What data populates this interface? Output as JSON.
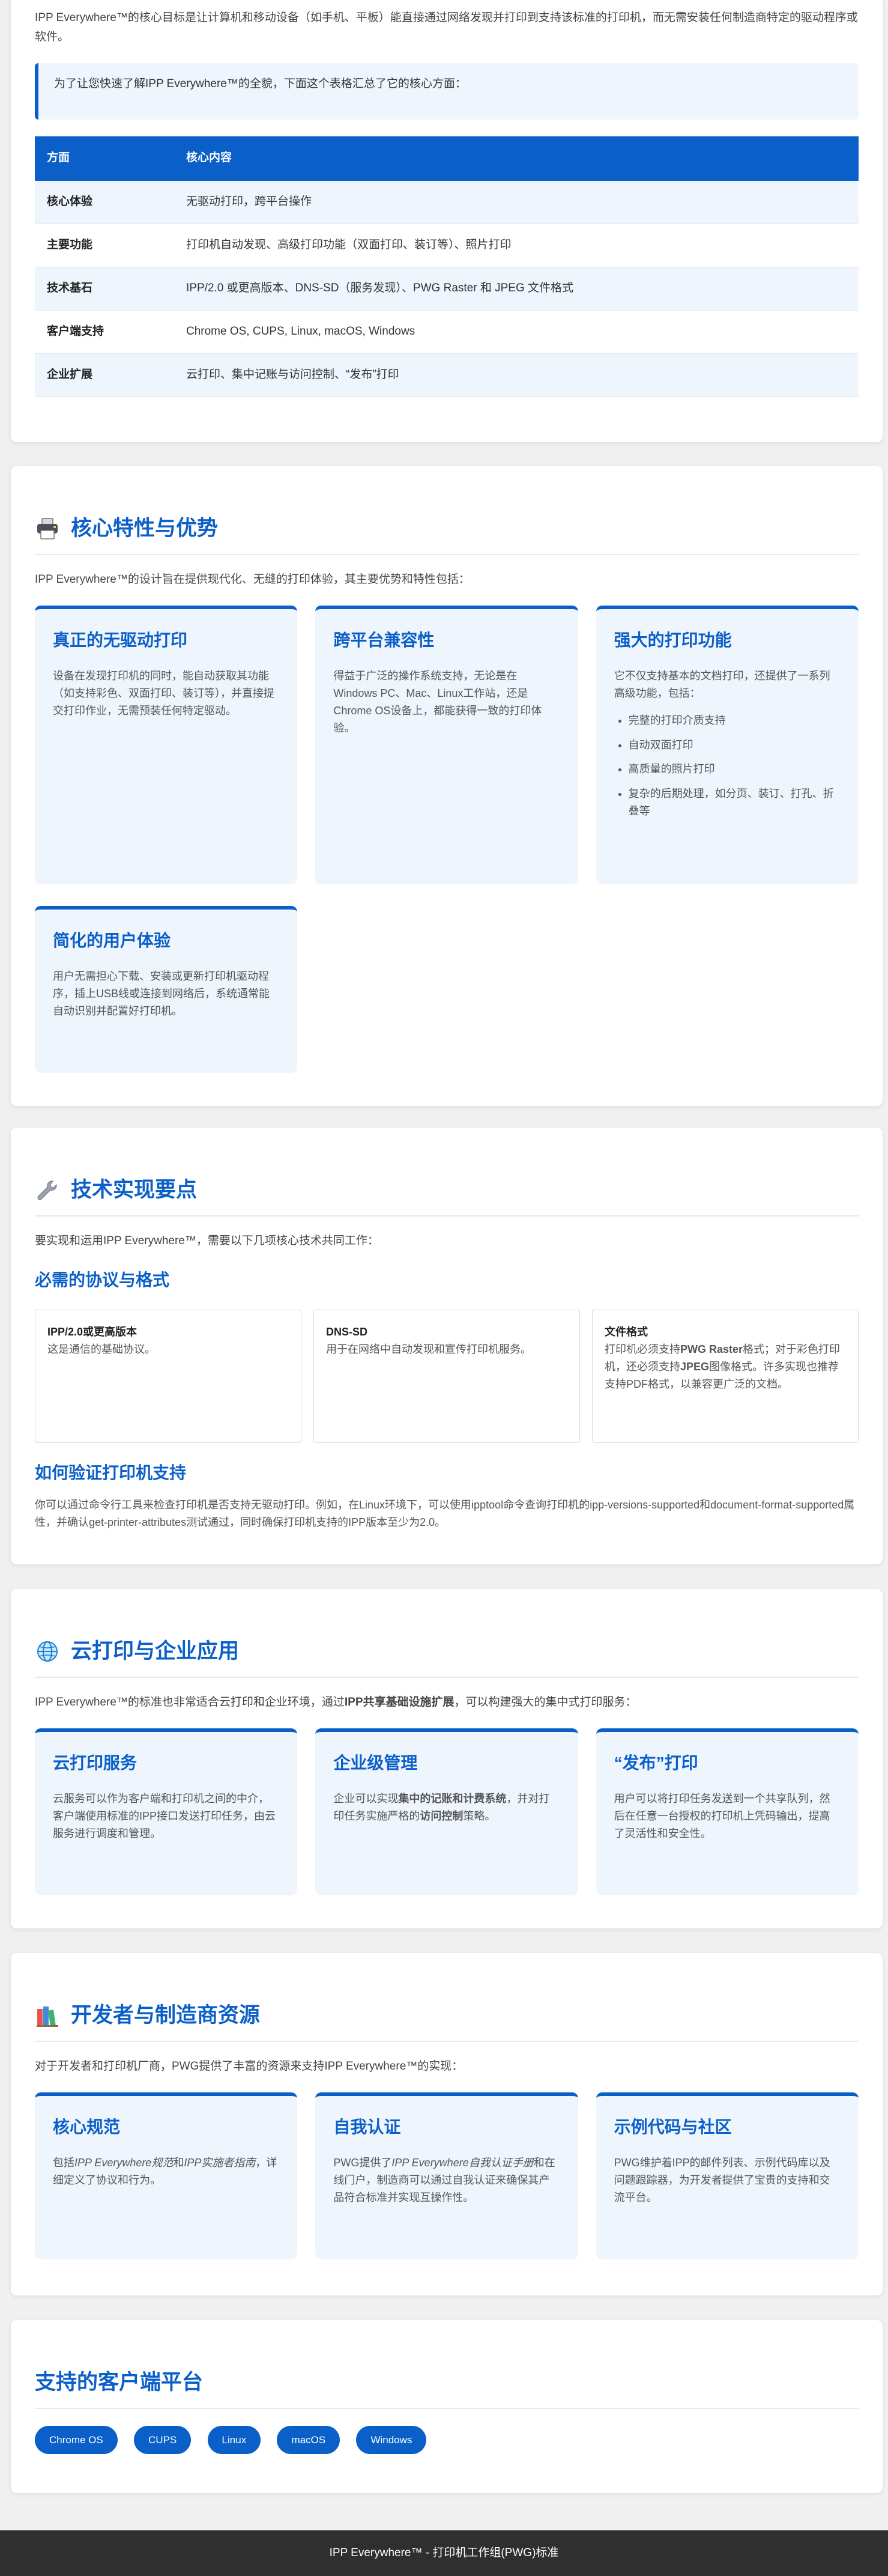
{
  "overview": {
    "intro": "IPP Everywhere™的核心目标是让计算机和移动设备（如手机、平板）能直接通过网络发现并打印到支持该标准的打印机，而无需安装任何制造商特定的驱动程序或软件。",
    "callout": "为了让您快速了解IPP Everywhere™的全貌，下面这个表格汇总了它的核心方面：",
    "table_headers": [
      "方面",
      "核心内容"
    ],
    "rows": [
      {
        "aspect": "核心体验",
        "content": "无驱动打印，跨平台操作"
      },
      {
        "aspect": "主要功能",
        "content": "打印机自动发现、高级打印功能（双面打印、装订等）、照片打印"
      },
      {
        "aspect": "技术基石",
        "content": "IPP/2.0 或更高版本、DNS-SD（服务发现）、PWG Raster 和 JPEG 文件格式"
      },
      {
        "aspect": "客户端支持",
        "content": "Chrome OS, CUPS, Linux, macOS, Windows"
      },
      {
        "aspect": "企业扩展",
        "content": "云打印、集中记账与访问控制、“发布”打印"
      }
    ]
  },
  "features": {
    "title": "核心特性与优势",
    "lead": "IPP Everywhere™的设计旨在提供现代化、无缝的打印体验，其主要优势和特性包括：",
    "cards": [
      {
        "title": "真正的无驱动打印",
        "body": "设备在发现打印机的同时，能自动获取其功能（如支持彩色、双面打印、装订等），并直接提交打印作业，无需预装任何特定驱动。"
      },
      {
        "title": "跨平台兼容性",
        "body": "得益于广泛的操作系统支持，无论是在Windows PC、Mac、Linux工作站，还是Chrome OS设备上，都能获得一致的打印体验。"
      },
      {
        "title": "强大的打印功能",
        "body": "它不仅支持基本的文档打印，还提供了一系列高级功能，包括：",
        "items": [
          "完整的打印介质支持",
          "自动双面打印",
          "高质量的照片打印",
          "复杂的后期处理，如分页、装订、打孔、折叠等"
        ]
      },
      {
        "title": "简化的用户体验",
        "body": "用户无需担心下载、安装或更新打印机驱动程序，插上USB线或连接到网络后，系统通常能自动识别并配置好打印机。"
      }
    ]
  },
  "tech": {
    "title": "技术实现要点",
    "lead": "要实现和运用IPP Everywhere™，需要以下几项核心技术共同工作：",
    "protocols_heading": "必需的协议与格式",
    "protocols": [
      {
        "name": "IPP/2.0或更高版本",
        "desc": "这是通信的基础协议。"
      },
      {
        "name": "DNS-SD",
        "desc": "用于在网络中自动发现和宣传打印机服务。"
      },
      {
        "name": "文件格式",
        "desc_1": "打印机必须支持",
        "bold_1": "PWG Raster",
        "desc_2": "格式；对于彩色打印机，还必须支持",
        "bold_2": "JPEG",
        "desc_3": "图像格式。许多实现也推荐支持PDF格式，以兼容更广泛的文档。"
      }
    ],
    "verify_heading": "如何验证打印机支持",
    "verify_text": "你可以通过命令行工具来检查打印机是否支持无驱动打印。例如，在Linux环境下，可以使用ipptool命令查询打印机的ipp-versions-supported和document-format-supported属性，并确认get-printer-attributes测试通过，同时确保打印机支持的IPP版本至少为2.0。"
  },
  "cloud": {
    "title": "云打印与企业应用",
    "lead_1": "IPP Everywhere™的标准也非常适合云打印和企业环境，通过",
    "lead_bold": "IPP共享基础设施扩展",
    "lead_2": "，可以构建强大的集中式打印服务：",
    "cards": [
      {
        "title": "云打印服务",
        "body": "云服务可以作为客户端和打印机之间的中介，客户端使用标准的IPP接口发送打印任务，由云服务进行调度和管理。"
      },
      {
        "title": "企业级管理",
        "body_1": "企业可以实现",
        "bold_1": "集中的记账和计费系统",
        "body_2": "，并对打印任务实施严格的",
        "bold_2": "访问控制",
        "body_3": "策略。"
      },
      {
        "title": "“发布”打印",
        "body": "用户可以将打印任务发送到一个共享队列，然后在任意一台授权的打印机上凭码输出，提高了灵活性和安全性。"
      }
    ]
  },
  "dev": {
    "title": "开发者与制造商资源",
    "lead": "对于开发者和打印机厂商，PWG提供了丰富的资源来支持IPP Everywhere™的实现：",
    "cards": [
      {
        "title": "核心规范",
        "body_1": "包括",
        "em_1": "IPP Everywhere规范",
        "body_2": "和",
        "em_2": "IPP实施者指南",
        "body_3": "，详细定义了协议和行为。"
      },
      {
        "title": "自我认证",
        "body_1": "PWG提供了",
        "em_1": "IPP Everywhere自我认证手册",
        "body_2": "和在线门户，制造商可以通过自我认证来确保其产品符合标准并实现互操作性。"
      },
      {
        "title": "示例代码与社区",
        "body": "PWG维护着IPP的邮件列表、示例代码库以及问题跟踪器，为开发者提供了宝贵的支持和交流平台。"
      }
    ]
  },
  "platforms": {
    "title": "支持的客户端平台",
    "items": [
      "Chrome OS",
      "CUPS",
      "Linux",
      "macOS",
      "Windows"
    ]
  },
  "footer": {
    "text": "IPP Everywhere™ - 打印机工作组(PWG)标准"
  }
}
